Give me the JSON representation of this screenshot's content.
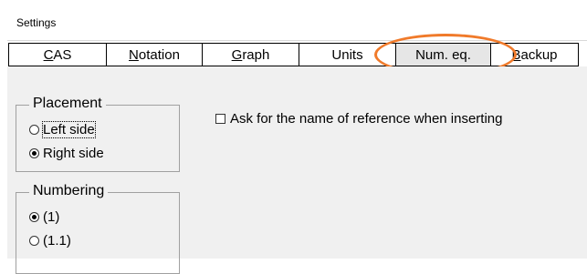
{
  "window": {
    "title": "Settings"
  },
  "tabs": [
    {
      "label_pre": "",
      "label_u": "C",
      "label_post": "AS",
      "selected": false
    },
    {
      "label_pre": "",
      "label_u": "N",
      "label_post": "otation",
      "selected": false
    },
    {
      "label_pre": "",
      "label_u": "G",
      "label_post": "raph",
      "selected": false
    },
    {
      "label_pre": "Units",
      "label_u": "",
      "label_post": "",
      "selected": false
    },
    {
      "label_pre": "Num. eq.",
      "label_u": "",
      "label_post": "",
      "selected": true
    },
    {
      "label_pre": "",
      "label_u": "B",
      "label_post": "ackup",
      "selected": false
    }
  ],
  "colors": {
    "highlight": "#f07a2a",
    "panel": "#f0f0f0"
  },
  "placement": {
    "legend": "Placement",
    "options": [
      {
        "label": "Left side",
        "checked": false
      },
      {
        "label": "Right side",
        "checked": true
      }
    ]
  },
  "numbering": {
    "legend": "Numbering",
    "options": [
      {
        "label": "(1)",
        "checked": true
      },
      {
        "label": "(1.1)",
        "checked": false
      }
    ]
  },
  "ask_reference": {
    "label": "Ask for the name of reference when inserting",
    "checked": false
  }
}
